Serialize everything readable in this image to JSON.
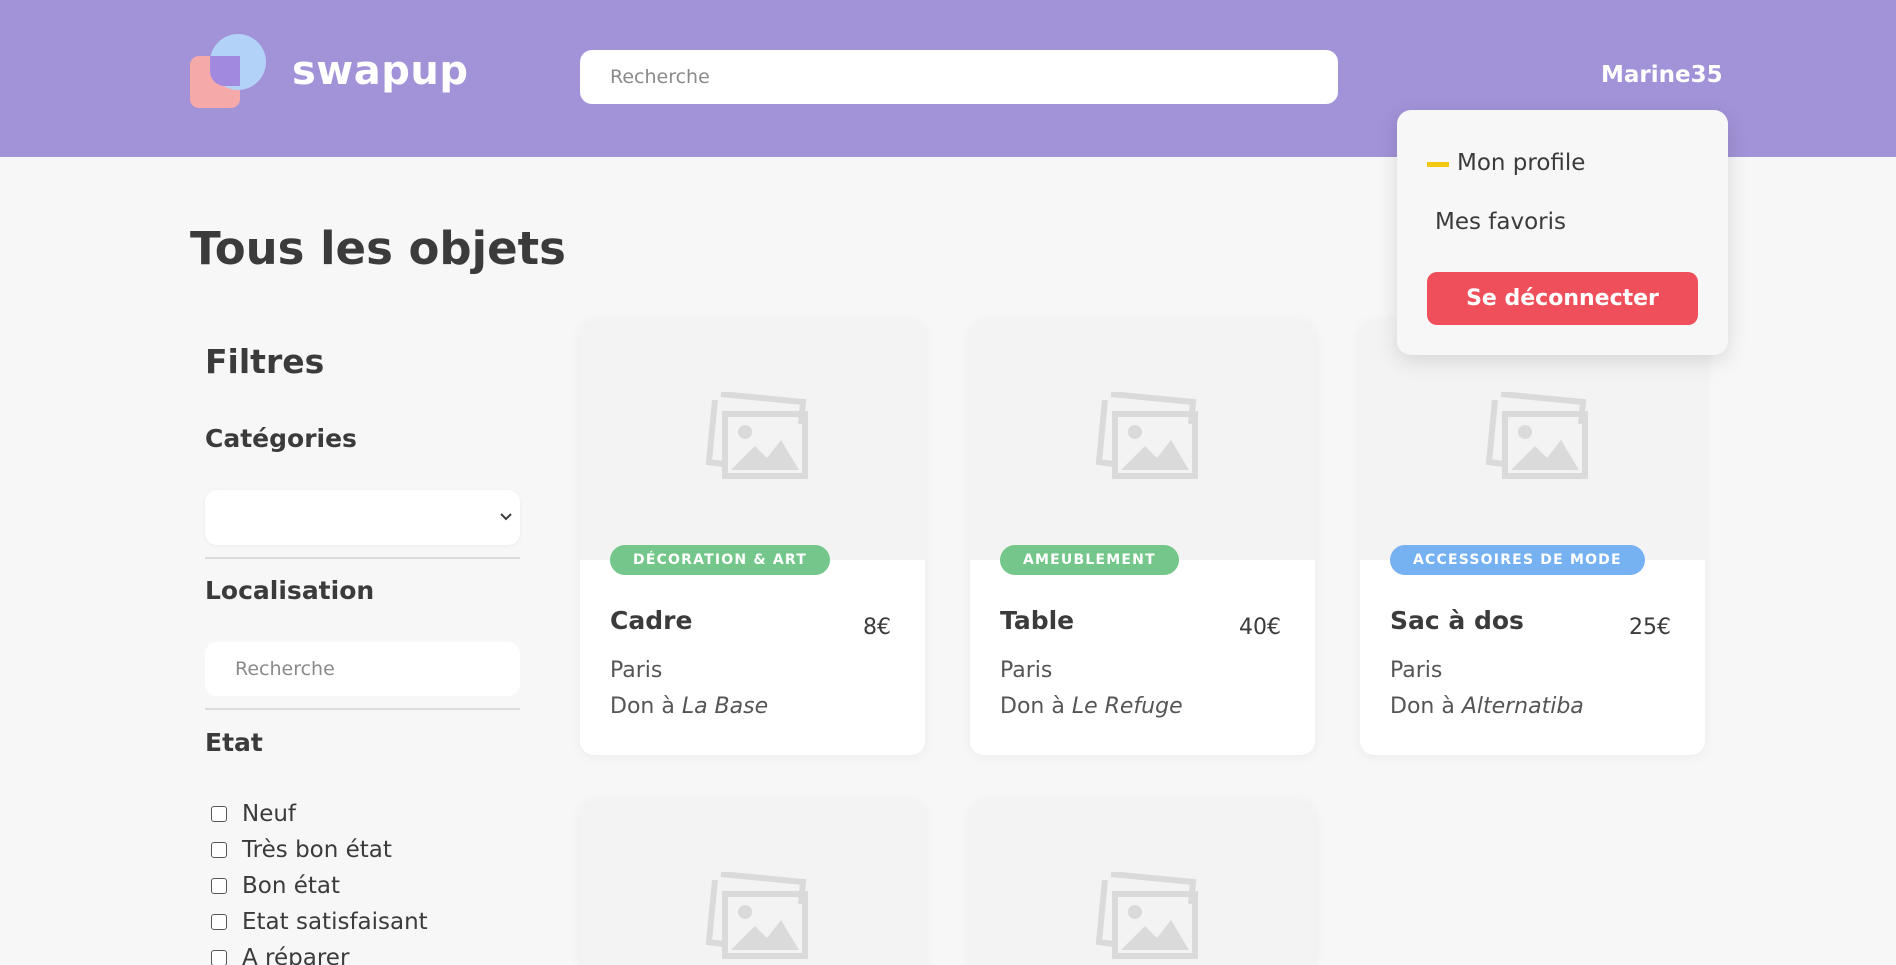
{
  "brand": {
    "name": "swapup"
  },
  "header": {
    "search_placeholder": "Recherche",
    "username": "Marine35"
  },
  "user_menu": {
    "profile": "Mon profile",
    "favorites": "Mes favoris",
    "logout": "Se déconnecter"
  },
  "page": {
    "title": "Tous les objets"
  },
  "filters": {
    "title": "Filtres",
    "categories_label": "Catégories",
    "categories_value": "",
    "location_label": "Localisation",
    "location_placeholder": "Recherche",
    "state_label": "Etat",
    "states": [
      "Neuf",
      "Très bon état",
      "Bon état",
      "Etat satisfaisant",
      "A réparer"
    ]
  },
  "colors": {
    "header": "#a292d8",
    "logout_button": "#ef4f5b",
    "badge_green": "#74c68a",
    "badge_blue": "#76b1f2",
    "active_marker": "#f2c811"
  },
  "cards": [
    {
      "category": "DÉCORATION & ART",
      "title": "Cadre",
      "price": "8€",
      "city": "Paris",
      "don_prefix": "Don à ",
      "org": "La Base"
    },
    {
      "category": "AMEUBLEMENT",
      "title": "Table",
      "price": "40€",
      "city": "Paris",
      "don_prefix": "Don à ",
      "org": "Le Refuge"
    },
    {
      "category": "ACCESSOIRES DE MODE",
      "title": "Sac à dos",
      "price": "25€",
      "city": "Paris",
      "don_prefix": "Don à ",
      "org": "Alternatiba"
    }
  ],
  "icons": {
    "card_image": "image-placeholder-icon",
    "select": "chevron-down-icon"
  }
}
